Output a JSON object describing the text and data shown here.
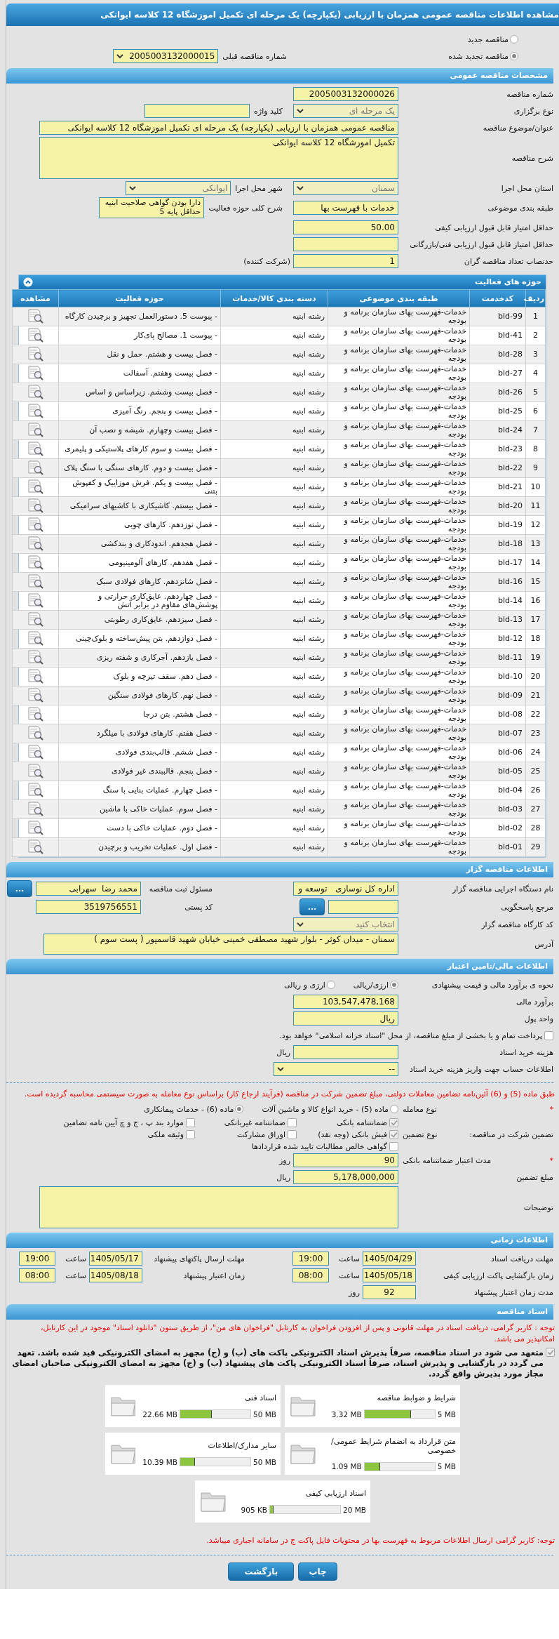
{
  "title": "مشاهده اطلاعات مناقصه عمومی همزمان با ارزیابی (یکپارچه) یک مرحله ای تکمیل اموزشگاه 12 کلاسه ایوانکی",
  "top_rows": [
    {
      "items": [
        {
          "kind": "radio",
          "label": "مناقصه جدید",
          "selected": false
        }
      ]
    },
    {
      "items": [
        {
          "kind": "radio",
          "label": "مناقصه تجدید شده",
          "selected": true
        },
        {
          "kind": "select",
          "label": "شماره مناقصه قبلی",
          "value": "2005003132000015",
          "disabled": false
        }
      ]
    }
  ],
  "general": {
    "title": "مشخصات مناقصه عمومی",
    "rows": [
      {
        "items": [
          {
            "kind": "input",
            "label": "شماره مناقصه",
            "value": "2005003132000026"
          }
        ]
      },
      {
        "items": [
          {
            "kind": "select",
            "label": "نوع برگزاری",
            "value": "یک مرحله ای",
            "disabled": true
          },
          {
            "kind": "input",
            "label": "کلید واژه"
          }
        ]
      },
      {
        "items": [
          {
            "kind": "wide-input",
            "label": "عنوان/موضوع مناقصه",
            "value": "مناقصه عمومی همزمان با ارزیابی (یکپارچه) یک مرحله ای تکمیل اموزشگاه 12 کلاسه ایوانکی"
          }
        ]
      },
      {
        "items": [
          {
            "kind": "textarea",
            "label": "شرح مناقصه",
            "value": "تکمیل اموزشگاه 12 کلاسه ایوانکی"
          }
        ]
      },
      {
        "items": [
          {
            "kind": "select",
            "label": "استان محل اجرا",
            "value": "سمنان",
            "disabled": true
          },
          {
            "kind": "select",
            "label": "شهر محل اجرا",
            "value": "ایوانکی",
            "disabled": true
          }
        ]
      },
      {
        "items": [
          {
            "kind": "input",
            "label": "طبقه بندی موضوعی",
            "value": "خدمات با فهرست بها"
          },
          {
            "kind": "small-textarea",
            "label": "شرح کلی حوزه فعالیت",
            "value": "دارا بودن گواهی صلاحیت ابنیه حداقل پایه 5"
          }
        ]
      },
      {
        "items": [
          {
            "kind": "input",
            "label": "حداقل امتیاز قابل قبول ارزیابی کیفی",
            "value": "50.00"
          }
        ]
      },
      {
        "items": [
          {
            "kind": "input",
            "label": "حداقل امتیاز قابل قبول ارزیابی فنی/بازرگانی"
          }
        ]
      },
      {
        "items": [
          {
            "kind": "input",
            "label": "حدنصاب تعداد مناقصه گران",
            "value": "1",
            "suffix": "(شرکت کننده)"
          }
        ]
      }
    ]
  },
  "activities": {
    "title": "حوزه های فعالیت",
    "columns": [
      "ردیف",
      "کدخدمت",
      "طبقه بندی موضوعی",
      "دسته بندی کالا/خدمات",
      "حوزه فعالیت",
      "مشاهده"
    ],
    "rows": [
      [
        "1",
        "bld-99",
        "خدمات-فهرست بهای سازمان برنامه و بودجه",
        "رشته ابنیه",
        "- پیوست 5. دستورالعمل تجهیز و برچیدن کارگاه"
      ],
      [
        "2",
        "bld-41",
        "خدمات-فهرست بهای سازمان برنامه و بودجه",
        "رشته ابنیه",
        "- پیوست 1. مصالح پای‌کار"
      ],
      [
        "3",
        "bld-28",
        "خدمات-فهرست بهای سازمان برنامه و بودجه",
        "رشته ابنیه",
        "- فصل بیست و هشتم. حمل و نقل"
      ],
      [
        "4",
        "bld-27",
        "خدمات-فهرست بهای سازمان برنامه و بودجه",
        "رشته ابنیه",
        "- فصل بیست وهفتم. آسفالت"
      ],
      [
        "5",
        "bld-26",
        "خدمات-فهرست بهای سازمان برنامه و بودجه",
        "رشته ابنیه",
        "- فصل بیست وششم. زیراساس و اساس"
      ],
      [
        "6",
        "bld-25",
        "خدمات-فهرست بهای سازمان برنامه و بودجه",
        "رشته ابنیه",
        "- فصل بیست و پنجم. رنگ آمیزی"
      ],
      [
        "7",
        "bld-24",
        "خدمات-فهرست بهای سازمان برنامه و بودجه",
        "رشته ابنیه",
        "- فصل بیست وچهارم. شیشه و نصب آن"
      ],
      [
        "8",
        "bld-23",
        "خدمات-فهرست بهای سازمان برنامه و بودجه",
        "رشته ابنیه",
        "- فصل بیست و سوم کارهای پلاستیکی و پلیمری"
      ],
      [
        "9",
        "bld-22",
        "خدمات-فهرست بهای سازمان برنامه و بودجه",
        "رشته ابنیه",
        "- فصل بیست و دوم. کارهای سنگی با سنگ پلاک"
      ],
      [
        "10",
        "bld-21",
        "خدمات-فهرست بهای سازمان برنامه و بودجه",
        "رشته ابنیه",
        "- فصل بیست و یکم. فرش موزاییک و کفپوش بتنی"
      ],
      [
        "11",
        "bld-20",
        "خدمات-فهرست بهای سازمان برنامه و بودجه",
        "رشته ابنیه",
        "- فصل بیستم. کاشیکاری با کاشیهای سرامیکی"
      ],
      [
        "12",
        "bld-19",
        "خدمات-فهرست بهای سازمان برنامه و بودجه",
        "رشته ابنیه",
        "- فصل نوزدهم. کارهای چوبی"
      ],
      [
        "13",
        "bld-18",
        "خدمات-فهرست بهای سازمان برنامه و بودجه",
        "رشته ابنیه",
        "- فصل هجدهم. اندودکاری و بندکشی"
      ],
      [
        "14",
        "bld-17",
        "خدمات-فهرست بهای سازمان برنامه و بودجه",
        "رشته ابنیه",
        "- فصل هفدهم. کارهای آلومینیومی"
      ],
      [
        "15",
        "bld-16",
        "خدمات-فهرست بهای سازمان برنامه و بودجه",
        "رشته ابنیه",
        "- فصل شانزدهم. کارهای فولادی سبک"
      ],
      [
        "16",
        "bld-14",
        "خدمات-فهرست بهای سازمان برنامه و بودجه",
        "رشته ابنیه",
        "- فصل چهاردهم. عایق‌کاری حرارتی و پوشش‌های مقاوم در برابر آتش"
      ],
      [
        "17",
        "bld-13",
        "خدمات-فهرست بهای سازمان برنامه و بودجه",
        "رشته ابنیه",
        "- فصل سیزدهم. عایق‌کاری رطوبتی"
      ],
      [
        "18",
        "bld-12",
        "خدمات-فهرست بهای سازمان برنامه و بودجه",
        "رشته ابنیه",
        "- فصل دوازدهم. بتن پیش‌ساخته و بلوک‌چینی"
      ],
      [
        "19",
        "bld-11",
        "خدمات-فهرست بهای سازمان برنامه و بودجه",
        "رشته ابنیه",
        "- فصل یازدهم. آجرکاری و شفته ریزی"
      ],
      [
        "20",
        "bld-10",
        "خدمات-فهرست بهای سازمان برنامه و بودجه",
        "رشته ابنیه",
        "- فصل دهم. سقف تیرچه و بلوک"
      ],
      [
        "21",
        "bld-09",
        "خدمات-فهرست بهای سازمان برنامه و بودجه",
        "رشته ابنیه",
        "- فصل نهم. کارهای فولادی سنگین"
      ],
      [
        "22",
        "bld-08",
        "خدمات-فهرست بهای سازمان برنامه و بودجه",
        "رشته ابنیه",
        "- فصل هشتم. بتن درجا"
      ],
      [
        "23",
        "bld-07",
        "خدمات-فهرست بهای سازمان برنامه و بودجه",
        "رشته ابنیه",
        "- فصل هفتم. کارهای فولادی با میلگرد"
      ],
      [
        "24",
        "bld-06",
        "خدمات-فهرست بهای سازمان برنامه و بودجه",
        "رشته ابنیه",
        "- فصل ششم. قالب‌بندی فولادی"
      ],
      [
        "25",
        "bld-05",
        "خدمات-فهرست بهای سازمان برنامه و بودجه",
        "رشته ابنیه",
        "- فصل پنجم. قالببندی غیر فولادی"
      ],
      [
        "26",
        "bld-04",
        "خدمات-فهرست بهای سازمان برنامه و بودجه",
        "رشته ابنیه",
        "- فصل چهارم. عملیات بنایی با سنگ"
      ],
      [
        "27",
        "bld-03",
        "خدمات-فهرست بهای سازمان برنامه و بودجه",
        "رشته ابنیه",
        "- فصل سوم. عملیات خاکی با ماشین"
      ],
      [
        "28",
        "bld-02",
        "خدمات-فهرست بهای سازمان برنامه و بودجه",
        "رشته ابنیه",
        "- فصل دوم. عملیات خاکی با دست"
      ],
      [
        "29",
        "bld-01",
        "خدمات-فهرست بهای سازمان برنامه و بودجه",
        "رشته ابنیه",
        "- فصل اول. عملیات تخریب و برچیدن"
      ]
    ]
  },
  "tenderer": {
    "title": "اطلاعات مناقصه گزار",
    "rows": [
      {
        "items": [
          {
            "kind": "input",
            "label": "نام دستگاه اجرایی مناقصه گزار",
            "value": "اداره کل نوسازی   توسعه و"
          },
          {
            "kind": "input",
            "label": "مسئول ثبت مناقصه",
            "value": "محمد رضا  سهرابی",
            "button": "..."
          }
        ]
      },
      {
        "items": [
          {
            "kind": "short-input",
            "label": "مرجع پاسخگویی",
            "button": "..."
          },
          {
            "kind": "input",
            "label": "کد پستی",
            "value": "3519756551"
          }
        ]
      },
      {
        "items": [
          {
            "kind": "select",
            "label": "کد کارگاه مناقصه گزار",
            "value": "انتخاب کنید",
            "disabled": true
          }
        ]
      },
      {
        "items": [
          {
            "kind": "address",
            "label": "آدرس",
            "value": "سمنان - میدان کوثر - بلوار شهید مصطفی خمینی خیابان شهید قاسمپور ( پست سوم )"
          }
        ]
      }
    ]
  },
  "finance": {
    "title": "اطلاعات مالی/تامین اعتبار",
    "rows": [
      {
        "items": [
          {
            "kind": "radios",
            "label": "نحوه ی برآورد مالی و قیمت پیشنهادی",
            "options": [
              {
                "label": "ارزی/ریالی",
                "selected": true
              },
              {
                "label": "ارزی و ریالی",
                "selected": false
              }
            ]
          }
        ]
      },
      {
        "items": [
          {
            "kind": "input",
            "label": "برآورد مالی",
            "value": "103,547,478,168"
          }
        ]
      },
      {
        "items": [
          {
            "kind": "input",
            "label": "واحد پول",
            "value": "ریال"
          }
        ]
      },
      {
        "items": [
          {
            "kind": "checkbox",
            "label": "پرداخت تمام و یا بخشی از مبلغ مناقصه، از محل \"اسناد خزانه اسلامی\" خواهد بود.",
            "checked": false
          }
        ]
      },
      {
        "items": [
          {
            "kind": "input",
            "label": "هزینه خرید اسناد",
            "suffix": "ریال"
          }
        ]
      },
      {
        "items": [
          {
            "kind": "wide-select",
            "label": "اطلاعات حساب جهت واریز هزینه خرید اسناد",
            "value": "--",
            "disabled": false
          }
        ]
      }
    ],
    "notice": "طبق ماده (5) و (6) آئین‌نامه تضامین معاملات دولتی، مبلغ تضمین شرکت در مناقصه (فرآیند ارجاع کار) براساس نوع معامله به صورت سیستمی محاسبه گردیده است.",
    "guarantee_rows": [
      {
        "items": [
          {
            "kind": "radios",
            "mark": "*",
            "label": "نوع معامله",
            "options": [
              {
                "label": "ماده (5) - خرید انواع کالا و ماشین آلات",
                "selected": false
              },
              {
                "label": "ماده (6) - خدمات پیمانکاری",
                "selected": true
              }
            ]
          }
        ]
      },
      {
        "items": [
          {
            "kind": "checks",
            "label": "تضمین شرکت در مناقصه:",
            "sublabel": "نوع تضمین",
            "options": [
              {
                "label": "ضمانتنامه بانکی",
                "checked": true
              },
              {
                "label": "ضمانتنامه غیربانکی",
                "checked": false
              },
              {
                "label": "موارد بند پ ، ج و چ آیین نامه تضامین",
                "checked": false
              },
              {
                "label": "فیش بانکی (وجه نقد)",
                "checked": true
              },
              {
                "label": "اوراق مشارکت",
                "checked": false
              },
              {
                "label": "وثیقه ملکی",
                "checked": false
              },
              {
                "label": "گواهی خالص مطالبات تایید شده قراردادها",
                "checked": false
              }
            ]
          }
        ]
      },
      {
        "items": [
          {
            "kind": "input",
            "mark": "*",
            "label": "مدت اعتبار ضمانتنامه بانکی",
            "value": "90",
            "suffix": "روز"
          }
        ]
      },
      {
        "items": [
          {
            "kind": "input",
            "label": "مبلغ تضمین",
            "value": "5,178,000,000",
            "suffix": "ریال"
          }
        ]
      },
      {
        "items": [
          {
            "kind": "textarea",
            "label": "توضیحات"
          }
        ]
      }
    ]
  },
  "timing": {
    "title": "اطلاعات زمانی",
    "rows": [
      {
        "items": [
          {
            "kind": "datetime",
            "label": "مهلت دریافت اسناد",
            "date": "1405/04/29",
            "time_label": "ساعت",
            "time": "19:00"
          },
          {
            "kind": "datetime",
            "label": "مهلت ارسال پاکتهای پیشنهاد",
            "date": "1405/05/17",
            "time_label": "ساعت",
            "time": "19:00"
          }
        ]
      },
      {
        "items": [
          {
            "kind": "datetime",
            "label": "زمان بازگشایی پاکت ارزیابی کیفی",
            "date": "1405/05/18",
            "time_label": "ساعت",
            "time": "08:00"
          },
          {
            "kind": "datetime",
            "label": "زمان اعتبار پیشنهاد",
            "date": "1405/08/18",
            "time_label": "ساعت",
            "time": "08:00"
          }
        ]
      },
      {
        "items": [
          {
            "kind": "date-input",
            "label": "مدت زمان اعتبار پیشنهاد",
            "value": "92",
            "suffix": "روز"
          }
        ]
      }
    ]
  },
  "documents": {
    "title": "اسناد مناقصه",
    "notice": "توجه : کاربر گرامی، دریافت اسناد در مهلت قانونی و پس از افزودن فراخوان به کارتابل \"فراخوان های من\"، از طریق ستون \"دانلود اسناد\" موجود در این کارتابل، امکانپذیر می باشد.",
    "commitment": {
      "text": "متعهد می شود در اسناد مناقصه، صرفاً پذیرش اسناد الکترونیکی پاکت های (ب) و (ج) مجهز به امضای الکترونیکی قید شده باشد. تعهد می گردد در بازگشایی و پذیرش اسناد، صرفاً اسناد الکترونیکی پاکت های پیشنهاد (ب) و (ج) مجهز به امضای الکترونیکی صاحبان امضای مجاز مورد پذیرش واقع گردد.",
      "checked": true
    },
    "files": [
      {
        "name": "شرایط و ضوابط مناقصه",
        "max": "5 MB",
        "size": "3.32 MB",
        "level": 0.66
      },
      {
        "name": "اسناد فنی",
        "max": "50 MB",
        "size": "22.66 MB",
        "level": 0.45
      },
      {
        "name": "متن قرارداد به انضمام شرایط عمومی/خصوصی",
        "max": "5 MB",
        "size": "1.09 MB",
        "level": 0.22
      },
      {
        "name": "سایر مدارک/اطلاعات",
        "max": "50 MB",
        "size": "10.39 MB",
        "level": 0.21
      },
      {
        "name": "اسناد ارزیابی کیفی",
        "max": "20 MB",
        "size": "905 KB",
        "level": 0.05
      }
    ],
    "footnote": "توجه: کاربر گرامی ارسال اطلاعات مربوط به فهرست بها در محتویات فایل پاکت ج در سامانه اجباری میباشد."
  },
  "buttons": [
    "چاپ",
    "بازگشت"
  ]
}
